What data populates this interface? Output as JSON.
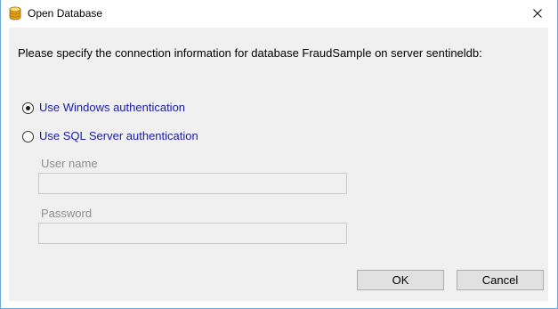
{
  "window": {
    "title": "Open Database",
    "icon": "database-icon",
    "close_icon": "close-icon"
  },
  "dialog": {
    "prompt": "Please specify the connection information for database FraudSample on server sentineldb:",
    "auth_options": [
      {
        "label": "Use Windows authentication",
        "selected": true
      },
      {
        "label": "Use SQL Server authentication",
        "selected": false
      }
    ],
    "username": {
      "label": "User name",
      "value": "",
      "enabled": false
    },
    "password": {
      "label": "Password",
      "value": "",
      "enabled": false
    }
  },
  "buttons": {
    "ok": "OK",
    "cancel": "Cancel"
  },
  "colors": {
    "window_border": "#6fa8dc",
    "client_background": "#f0f0f0",
    "radio_label_text": "#1a1aa6",
    "disabled_label_text": "#8f8f8f"
  }
}
